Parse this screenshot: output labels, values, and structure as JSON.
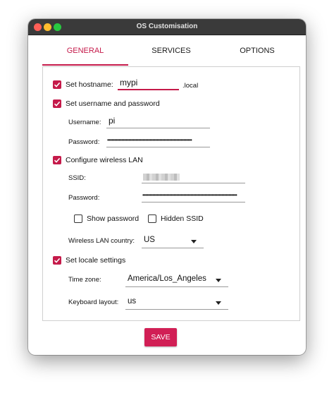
{
  "window": {
    "title": "OS Customisation"
  },
  "tabs": [
    {
      "label": "GENERAL",
      "active": true
    },
    {
      "label": "SERVICES",
      "active": false
    },
    {
      "label": "OPTIONS",
      "active": false
    }
  ],
  "general": {
    "hostname": {
      "label": "Set hostname:",
      "checked": true,
      "value": "mypi",
      "suffix": ".local"
    },
    "user": {
      "label": "Set username and password",
      "checked": true,
      "username_label": "Username:",
      "username_value": "pi",
      "password_label": "Password:",
      "password_value": "••••••••••••••••••••••••••••••••••••••••••••••••••••••••••••"
    },
    "wifi": {
      "label": "Configure wireless LAN",
      "checked": true,
      "ssid_label": "SSID:",
      "password_label": "Password:",
      "password_value": "•••••••••••••••••••••••••••••••••••••••••••••••••••••••••••••••••••",
      "show_password_label": "Show password",
      "show_password_checked": false,
      "hidden_ssid_label": "Hidden SSID",
      "hidden_ssid_checked": false,
      "country_label": "Wireless LAN country:",
      "country_value": "US"
    },
    "locale": {
      "label": "Set locale settings",
      "checked": true,
      "timezone_label": "Time zone:",
      "timezone_value": "America/Los_Angeles",
      "keyboard_label": "Keyboard layout:",
      "keyboard_value": "us"
    }
  },
  "save_label": "SAVE",
  "colors": {
    "accent": "#c51a4a",
    "titlebar": "#3a3a3a",
    "save_button": "#d11f55"
  }
}
